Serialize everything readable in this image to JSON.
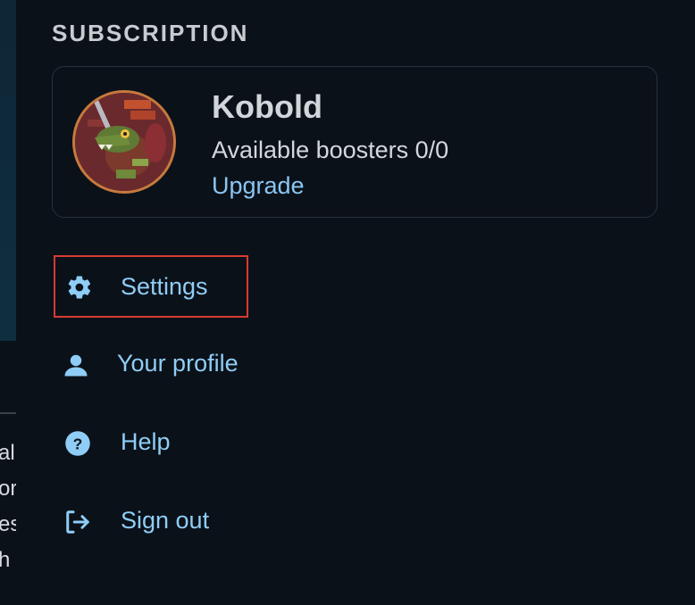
{
  "background": {
    "partial_text_lines": [
      "al",
      "or",
      "es",
      "h"
    ]
  },
  "subscription": {
    "section_title": "SUBSCRIPTION",
    "plan_name": "Kobold",
    "boosters_text": "Available boosters 0/0",
    "upgrade_label": "Upgrade",
    "avatar_icon": "kobold-avatar"
  },
  "menu": {
    "items": [
      {
        "label": "Settings",
        "icon": "gear-icon",
        "highlighted": true
      },
      {
        "label": "Your profile",
        "icon": "user-icon"
      },
      {
        "label": "Help",
        "icon": "help-circle-icon"
      },
      {
        "label": "Sign out",
        "icon": "sign-out-icon"
      }
    ]
  },
  "colors": {
    "background": "#0b1119",
    "link": "#8fcdf6",
    "highlight_border": "#d93a32",
    "card_border": "#26313d"
  }
}
